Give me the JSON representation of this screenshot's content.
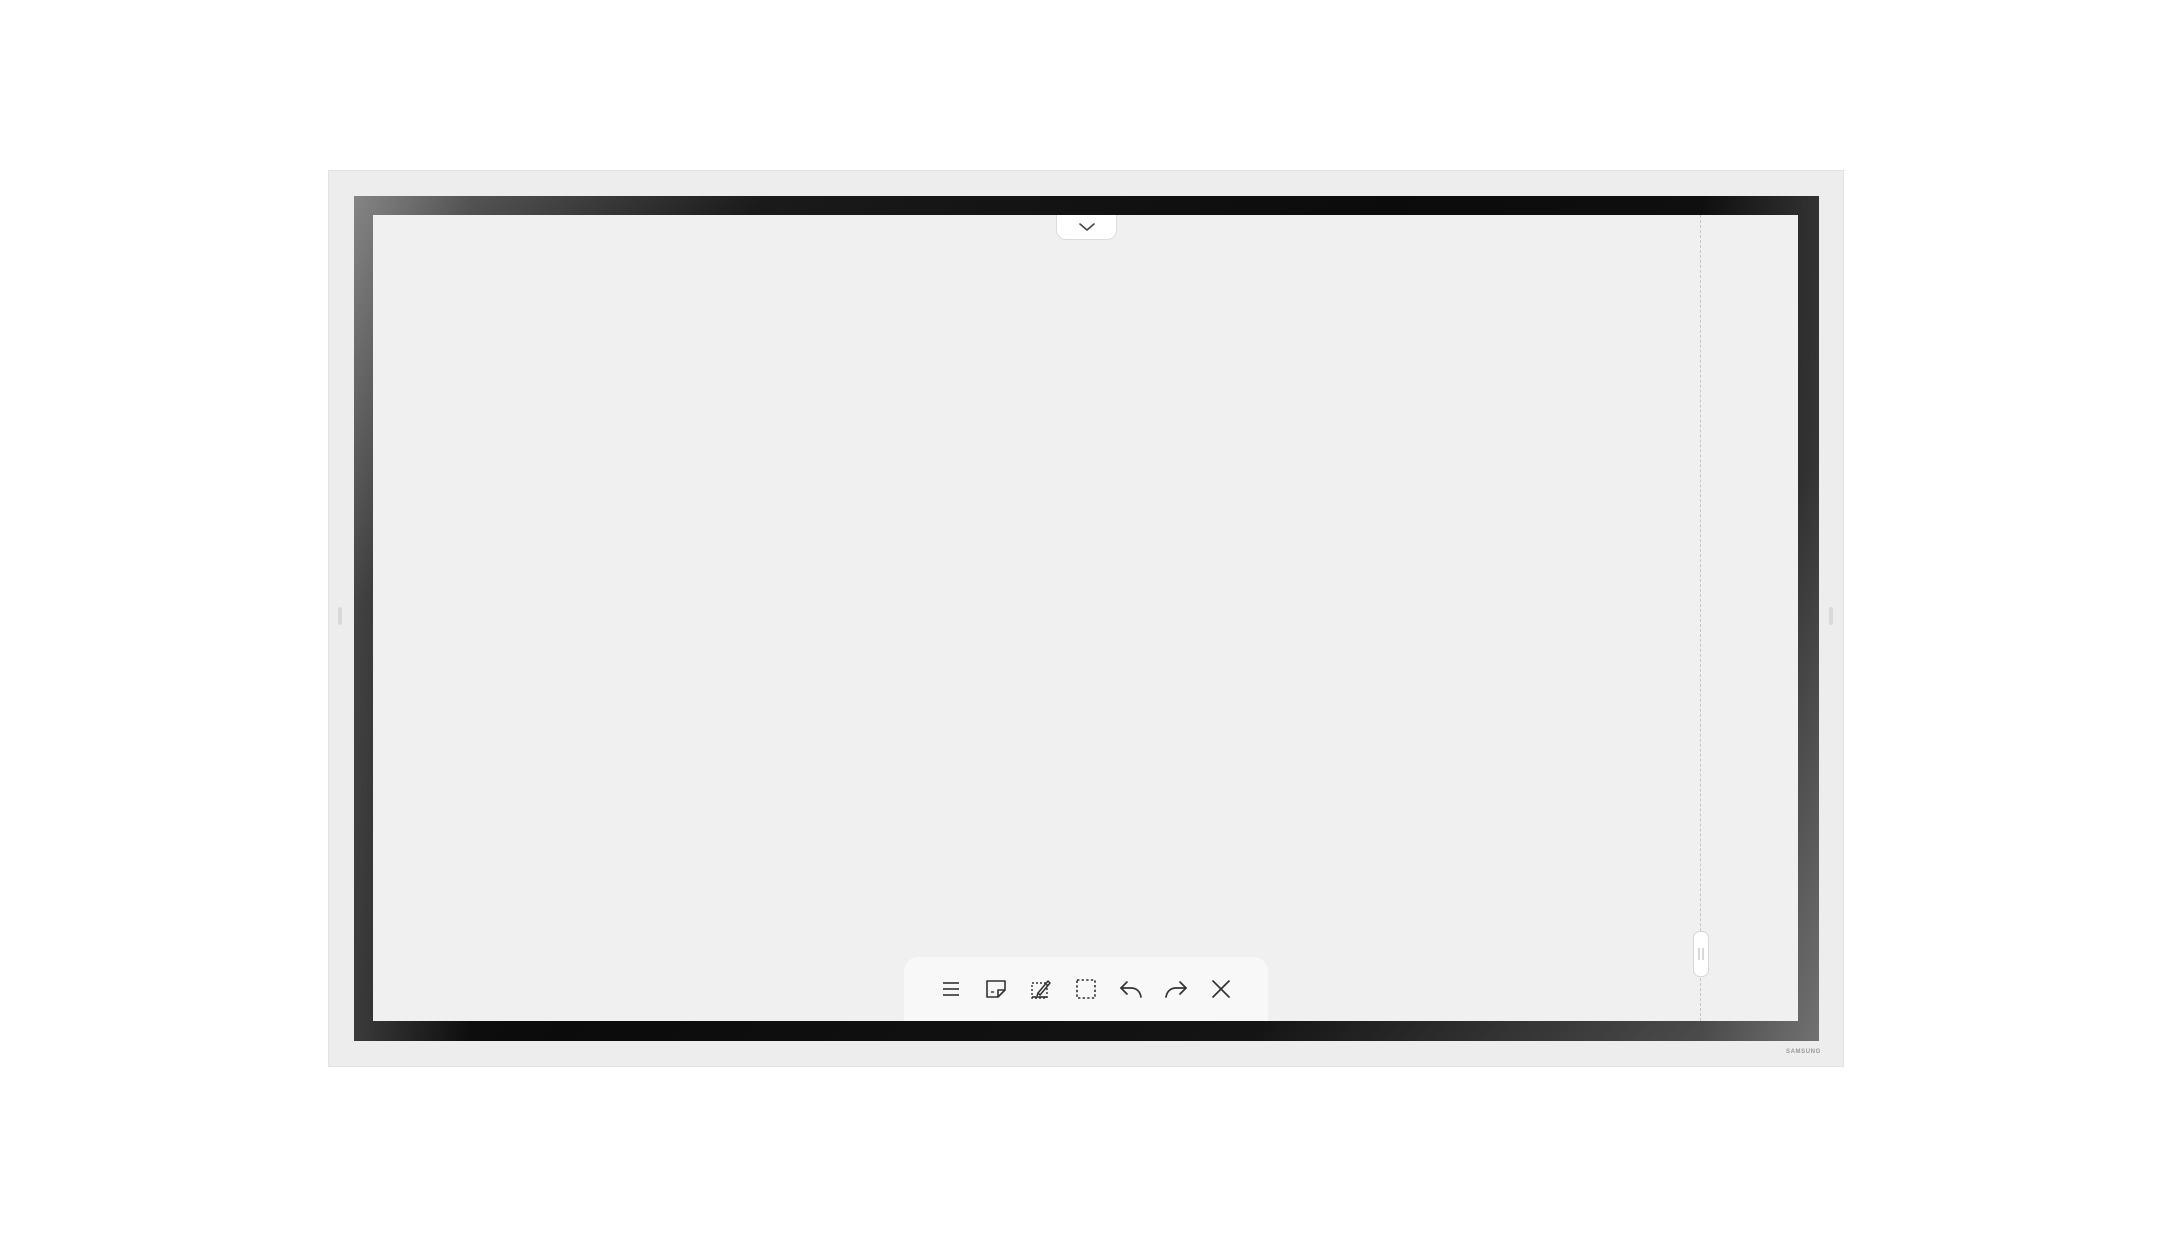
{
  "device": {
    "brand": "SAMSUNG"
  },
  "toolbar": {
    "tools": [
      {
        "name": "menu",
        "icon": "menu-icon"
      },
      {
        "name": "sticky-note",
        "icon": "sticky-note-icon"
      },
      {
        "name": "screen-capture",
        "icon": "capture-edit-icon"
      },
      {
        "name": "select",
        "icon": "dashed-select-icon"
      },
      {
        "name": "undo",
        "icon": "undo-icon"
      },
      {
        "name": "redo",
        "icon": "redo-icon"
      },
      {
        "name": "close",
        "icon": "close-icon"
      }
    ]
  },
  "colors": {
    "canvas": "#f0f0f0",
    "frame": "#ededed",
    "bezel": "#0b0b0b",
    "icon": "#333333"
  }
}
